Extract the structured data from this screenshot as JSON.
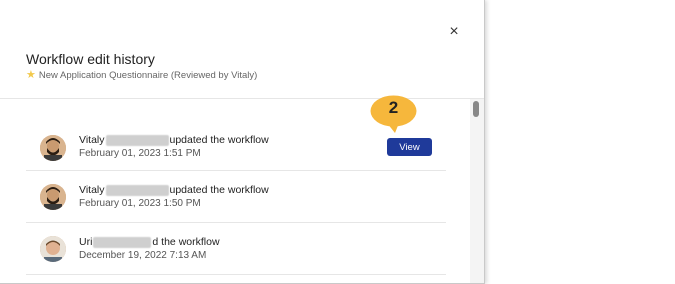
{
  "dialog": {
    "title": "Workflow edit history",
    "subtitle": "New Application Questionnaire (Reviewed by Vitaly)",
    "close_glyph": "×"
  },
  "entries": [
    {
      "name_prefix": "Vitaly",
      "action": "updated the workflow",
      "date": "February 01, 2023 1:51 PM",
      "avatar": "male-avatar-beard"
    },
    {
      "name_prefix": "Vitaly",
      "action": "updated the workflow",
      "date": "February 01, 2023 1:50 PM",
      "avatar": "male-avatar-beard"
    },
    {
      "name_prefix": "Uri",
      "action": "d the workflow",
      "date": "December 19, 2022 7:13 AM",
      "avatar": "male-avatar"
    }
  ],
  "view_button": {
    "label": "View"
  },
  "callout": {
    "number": "2",
    "color": "#f6b73c"
  },
  "colors": {
    "accent": "#1f3a9a",
    "star": "#f2c94c"
  }
}
